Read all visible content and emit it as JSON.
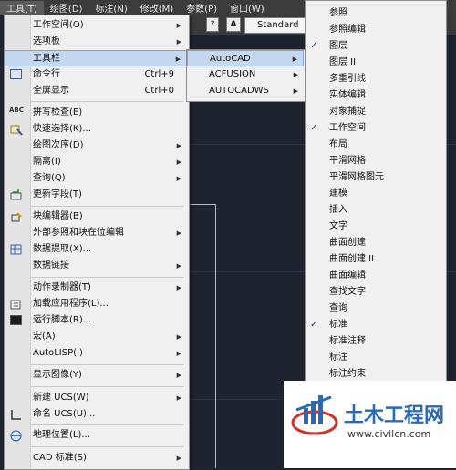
{
  "menubar": {
    "items": [
      "工具(T)",
      "绘图(D)",
      "标注(N)",
      "修改(M)",
      "参数(P)",
      "窗口(W)"
    ]
  },
  "toolbar": {
    "style_value": "Standard",
    "help_button": "?",
    "text_button": "A"
  },
  "tools_menu": {
    "items": [
      {
        "label": "工作空间(O)",
        "submenu": true
      },
      {
        "label": "选项板",
        "submenu": true
      },
      {
        "label": "工具栏",
        "submenu": true
      },
      {
        "label": "命令行",
        "shortcut": "Ctrl+9"
      },
      {
        "label": "全屏显示",
        "shortcut": "Ctrl+0"
      },
      {
        "label": "拼写检查(E)"
      },
      {
        "label": "快速选择(K)..."
      },
      {
        "label": "绘图次序(D)",
        "submenu": true
      },
      {
        "label": "隔离(I)",
        "submenu": true
      },
      {
        "label": "查询(Q)",
        "submenu": true
      },
      {
        "label": "更新字段(T)"
      },
      {
        "label": "块编辑器(B)"
      },
      {
        "label": "外部参照和块在位编辑",
        "submenu": true
      },
      {
        "label": "数据提取(X)..."
      },
      {
        "label": "数据链接",
        "submenu": true
      },
      {
        "label": "动作录制器(T)",
        "submenu": true
      },
      {
        "label": "加载应用程序(L)..."
      },
      {
        "label": "运行脚本(R)..."
      },
      {
        "label": "宏(A)",
        "submenu": true
      },
      {
        "label": "AutoLISP(I)",
        "submenu": true
      },
      {
        "label": "显示图像(Y)",
        "submenu": true
      },
      {
        "label": "新建 UCS(W)",
        "submenu": true
      },
      {
        "label": "命名 UCS(U)..."
      },
      {
        "label": "地理位置(L)..."
      },
      {
        "label": "CAD 标准(S)",
        "submenu": true
      }
    ],
    "icon_labels": {
      "spell": "ABC"
    }
  },
  "toolbar_submenu": {
    "items": [
      "AutoCAD",
      "ACFUSION",
      "AUTOCADWS"
    ]
  },
  "autocad_submenu": {
    "items": [
      {
        "label": "参照",
        "checked": false
      },
      {
        "label": "参照编辑",
        "checked": false
      },
      {
        "label": "图层",
        "checked": true
      },
      {
        "label": "图层 II",
        "checked": false
      },
      {
        "label": "多重引线",
        "checked": false
      },
      {
        "label": "实体编辑",
        "checked": false
      },
      {
        "label": "对象捕捉",
        "checked": false
      },
      {
        "label": "工作空间",
        "checked": true
      },
      {
        "label": "布局",
        "checked": false
      },
      {
        "label": "平滑网格",
        "checked": false
      },
      {
        "label": "平滑网格图元",
        "checked": false
      },
      {
        "label": "建模",
        "checked": false
      },
      {
        "label": "插入",
        "checked": false
      },
      {
        "label": "文字",
        "checked": false
      },
      {
        "label": "曲面创建",
        "checked": false
      },
      {
        "label": "曲面创建 II",
        "checked": false
      },
      {
        "label": "曲面编辑",
        "checked": false
      },
      {
        "label": "查找文字",
        "checked": false
      },
      {
        "label": "查询",
        "checked": false
      },
      {
        "label": "标准",
        "checked": true
      },
      {
        "label": "标准注释",
        "checked": false
      },
      {
        "label": "标注",
        "checked": false
      },
      {
        "label": "标注约束",
        "checked": false
      }
    ],
    "check_mark": "✓"
  },
  "watermark": {
    "title": "土木工程网",
    "url": "www.civilcn.com"
  },
  "colors": {
    "highlight": "#c4d8ef",
    "logo_blue": "#2a69b5",
    "logo_red": "#d0312d"
  }
}
